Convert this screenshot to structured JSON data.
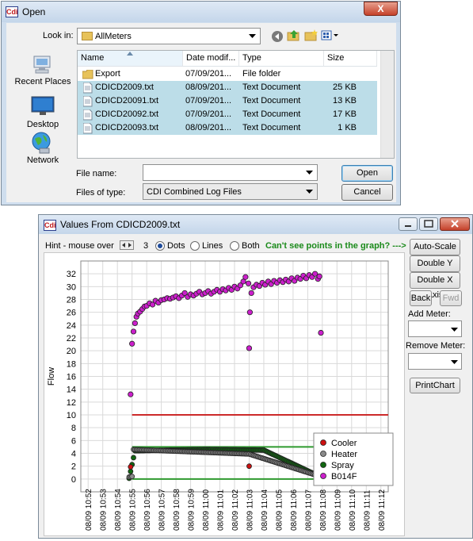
{
  "open_dialog": {
    "title": "Open",
    "look_in_label": "Look in:",
    "look_in_value": "AllMeters",
    "places": [
      "Recent Places",
      "Desktop",
      "Network"
    ],
    "columns": [
      "Name",
      "Date modif...",
      "Type",
      "Size"
    ],
    "files": [
      {
        "name": "Export",
        "date": "07/09/201...",
        "type": "File folder",
        "size": ""
      },
      {
        "name": "CDICD2009.txt",
        "date": "08/09/201...",
        "type": "Text Document",
        "size": "25 KB"
      },
      {
        "name": "CDICD20091.txt",
        "date": "07/09/201...",
        "type": "Text Document",
        "size": "13 KB"
      },
      {
        "name": "CDICD20092.txt",
        "date": "07/09/201...",
        "type": "Text Document",
        "size": "17 KB"
      },
      {
        "name": "CDICD20093.txt",
        "date": "08/09/201...",
        "type": "Text Document",
        "size": "1 KB"
      }
    ],
    "file_name_label": "File name:",
    "file_name_value": "",
    "file_type_label": "Files of type:",
    "file_type_value": "CDI Combined Log Files",
    "open_label": "Open",
    "cancel_label": "Cancel",
    "close_label": "X",
    "logo": "Cdi"
  },
  "chart_window": {
    "title": "Values From CDICD2009.txt",
    "logo": "Cdi",
    "hint_label": "Hint - mouse over",
    "hint_value": "3",
    "radios": [
      {
        "label": "Dots",
        "checked": true
      },
      {
        "label": "Lines",
        "checked": false
      },
      {
        "label": "Both",
        "checked": false
      }
    ],
    "warning": "Can't see points in the graph? --->",
    "buttons": {
      "auto_scale": "Auto-Scale",
      "double_y": "Double Y Axis",
      "double_x": "Double X Axis",
      "back": "Back",
      "fwd": "Fwd",
      "print": "PrintChart"
    },
    "add_meter_label": "Add Meter:",
    "remove_meter_label": "Remove Meter:"
  },
  "chart_data": {
    "type": "scatter",
    "ylabel": "Flow",
    "ylim": [
      -2,
      34
    ],
    "yticks": [
      0,
      2,
      4,
      6,
      8,
      10,
      12,
      14,
      16,
      18,
      20,
      22,
      24,
      26,
      28,
      30,
      32
    ],
    "xticks": [
      "08/09 10:52",
      "08/09 10:53",
      "08/09 10:54",
      "08/09 10:55",
      "08/09 10:56",
      "08/09 10:57",
      "08/09 10:58",
      "08/09 10:59",
      "08/09 11:00",
      "08/09 11:01",
      "08/09 11:02",
      "08/09 11:03",
      "08/09 11:04",
      "08/09 11:05",
      "08/09 11:06",
      "08/09 11:07",
      "08/09 11:08",
      "08/09 11:09",
      "08/09 11:10",
      "08/09 11:11",
      "08/09 11:12"
    ],
    "hlines": [
      {
        "y": 10,
        "color": "#cc2a2a"
      },
      {
        "y": 5,
        "color": "#2f9a2f"
      },
      {
        "y": 0,
        "color": "#2f9a2f"
      }
    ],
    "legend": "bottom-right",
    "series": [
      {
        "name": "Cooler",
        "color": "#cc1111",
        "points": [
          [
            2.9,
            1.9
          ],
          [
            11.0,
            2.0
          ],
          [
            15.9,
            0.8
          ]
        ]
      },
      {
        "name": "Heater",
        "color": "#8a8a8a",
        "points": [
          [
            2.8,
            0.3
          ],
          [
            3.0,
            0.4
          ],
          [
            3.1,
            4.6
          ],
          [
            11.0,
            3.9
          ],
          [
            16.0,
            0.3
          ]
        ]
      },
      {
        "name": "Spray",
        "color": "#116611",
        "points": [
          [
            2.8,
            0.1
          ],
          [
            3.2,
            4.4
          ],
          [
            8.0,
            4.6
          ],
          [
            12.0,
            4.5
          ],
          [
            16.1,
            0.1
          ]
        ]
      },
      {
        "name": "B014F",
        "color": "#cc1fcc",
        "points": [
          [
            2.9,
            13.2
          ],
          [
            3.0,
            21.1
          ],
          [
            3.1,
            23.0
          ],
          [
            3.2,
            24.3
          ],
          [
            3.3,
            25.3
          ],
          [
            3.4,
            25.8
          ],
          [
            3.55,
            26.1
          ],
          [
            3.7,
            26.5
          ],
          [
            3.85,
            26.9
          ],
          [
            4.0,
            27.0
          ],
          [
            4.2,
            27.4
          ],
          [
            4.4,
            27.2
          ],
          [
            4.6,
            27.8
          ],
          [
            4.8,
            27.5
          ],
          [
            5.0,
            27.9
          ],
          [
            5.2,
            28.0
          ],
          [
            5.4,
            28.2
          ],
          [
            5.6,
            28.1
          ],
          [
            5.8,
            28.3
          ],
          [
            6.0,
            28.5
          ],
          [
            6.2,
            28.2
          ],
          [
            6.4,
            28.6
          ],
          [
            6.6,
            29.0
          ],
          [
            6.8,
            28.4
          ],
          [
            7.0,
            28.8
          ],
          [
            7.2,
            28.6
          ],
          [
            7.4,
            28.9
          ],
          [
            7.6,
            29.2
          ],
          [
            7.8,
            28.8
          ],
          [
            8.0,
            29.0
          ],
          [
            8.2,
            29.3
          ],
          [
            8.4,
            28.9
          ],
          [
            8.6,
            29.2
          ],
          [
            8.8,
            29.5
          ],
          [
            9.0,
            29.2
          ],
          [
            9.2,
            29.6
          ],
          [
            9.4,
            29.4
          ],
          [
            9.6,
            29.8
          ],
          [
            9.8,
            29.5
          ],
          [
            10.0,
            30.0
          ],
          [
            10.2,
            29.7
          ],
          [
            10.4,
            30.2
          ],
          [
            10.6,
            30.8
          ],
          [
            10.75,
            31.5
          ],
          [
            10.95,
            30.5
          ],
          [
            11.0,
            20.4
          ],
          [
            11.05,
            26.0
          ],
          [
            11.15,
            29.0
          ],
          [
            11.3,
            29.9
          ],
          [
            11.5,
            30.3
          ],
          [
            11.7,
            30.1
          ],
          [
            11.9,
            30.6
          ],
          [
            12.1,
            30.3
          ],
          [
            12.3,
            30.8
          ],
          [
            12.5,
            30.4
          ],
          [
            12.7,
            30.9
          ],
          [
            12.9,
            30.6
          ],
          [
            13.1,
            31.0
          ],
          [
            13.3,
            30.7
          ],
          [
            13.5,
            31.1
          ],
          [
            13.7,
            30.8
          ],
          [
            13.9,
            31.3
          ],
          [
            14.1,
            30.9
          ],
          [
            14.3,
            31.4
          ],
          [
            14.5,
            31.2
          ],
          [
            14.7,
            31.7
          ],
          [
            14.9,
            31.3
          ],
          [
            15.1,
            31.8
          ],
          [
            15.3,
            31.5
          ],
          [
            15.5,
            32.0
          ],
          [
            15.7,
            31.2
          ],
          [
            15.8,
            31.6
          ],
          [
            15.9,
            22.8
          ],
          [
            16.0,
            0.7
          ],
          [
            16.1,
            0.3
          ],
          [
            16.2,
            0.2
          ]
        ]
      }
    ]
  }
}
